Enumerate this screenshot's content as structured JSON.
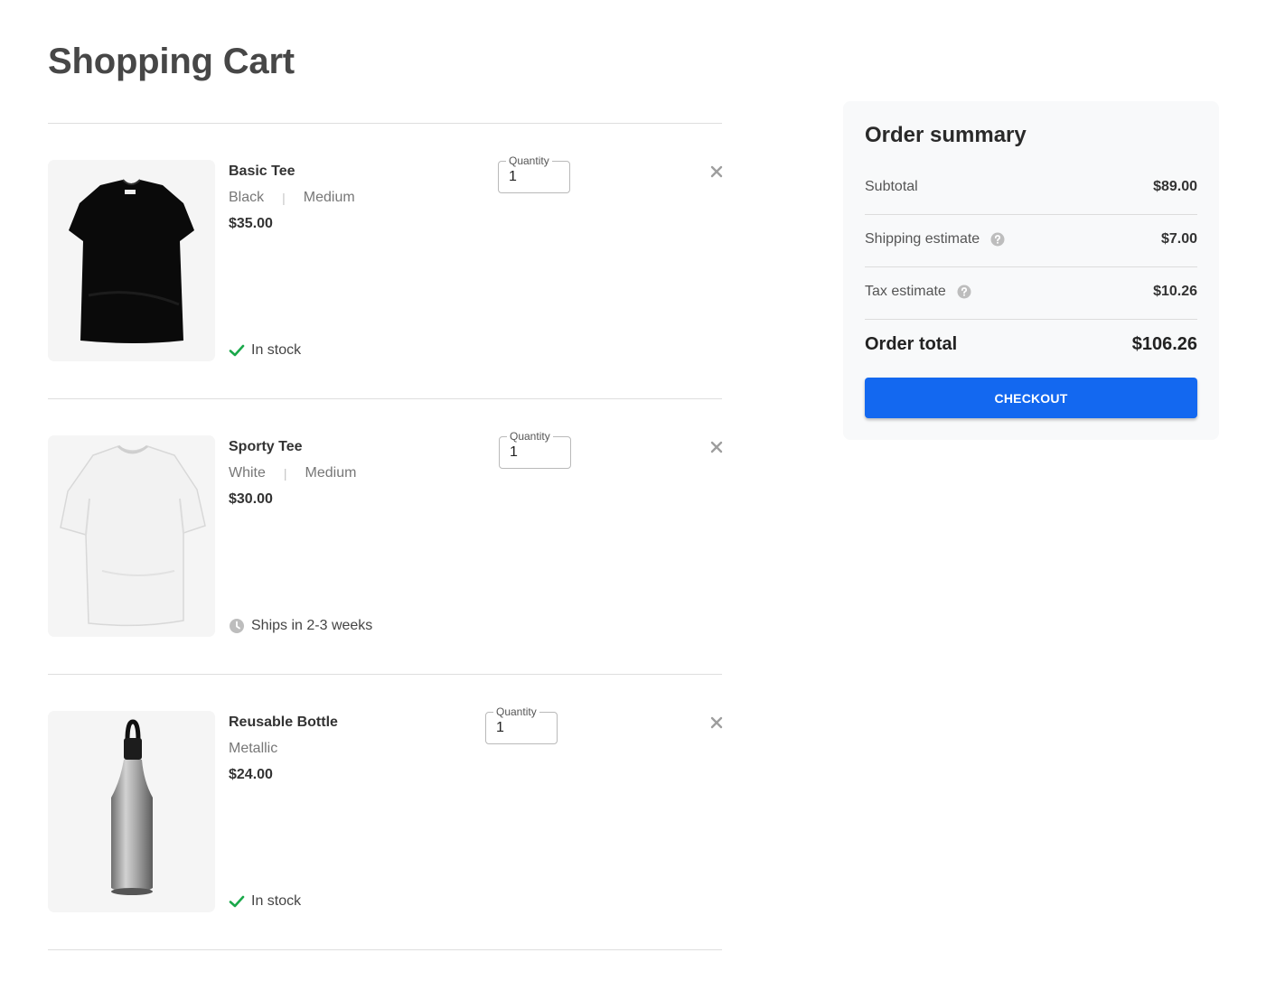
{
  "page_title": "Shopping Cart",
  "cart": {
    "items": [
      {
        "name": "Basic Tee",
        "color": "Black",
        "size": "Medium",
        "price": "$35.00",
        "quantity_label": "Quantity",
        "quantity": "1",
        "availability": "In stock",
        "availability_icon": "check-icon",
        "image": "black-tshirt"
      },
      {
        "name": "Sporty Tee",
        "color": "White",
        "size": "Medium",
        "price": "$30.00",
        "quantity_label": "Quantity",
        "quantity": "1",
        "availability": "Ships in 2-3 weeks",
        "availability_icon": "clock-icon",
        "image": "white-tshirt"
      },
      {
        "name": "Reusable Bottle",
        "color": "Metallic",
        "size": "",
        "price": "$24.00",
        "quantity_label": "Quantity",
        "quantity": "1",
        "availability": "In stock",
        "availability_icon": "check-icon",
        "image": "steel-bottle"
      }
    ],
    "remove_icon": "close-icon"
  },
  "summary": {
    "title": "Order summary",
    "subtotal_label": "Subtotal",
    "subtotal_value": "$89.00",
    "shipping_label": "Shipping estimate",
    "shipping_value": "$7.00",
    "tax_label": "Tax estimate",
    "tax_value": "$10.26",
    "total_label": "Order total",
    "total_value": "$106.26",
    "checkout_label": "CHECKOUT",
    "help_icon": "question-circle-icon"
  },
  "colors": {
    "accent": "#1368f0",
    "in_stock": "#1aa84a",
    "muted_icon": "#bdbdbd"
  }
}
